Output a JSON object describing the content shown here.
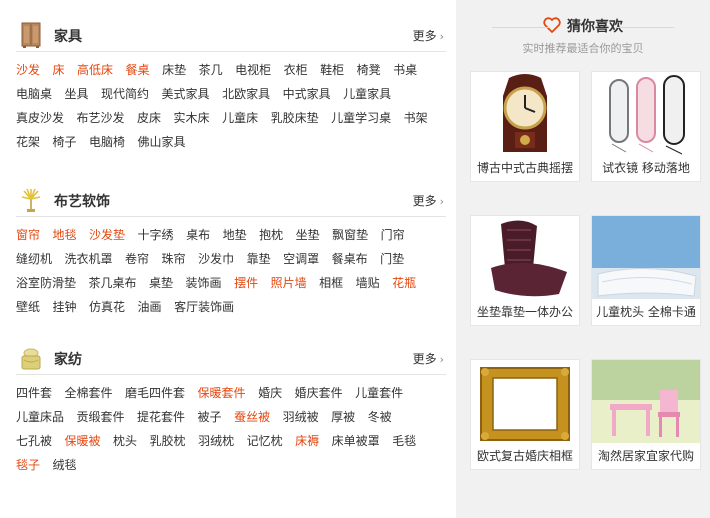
{
  "sections": [
    {
      "title": "家具",
      "more": "更多",
      "icon": "wardrobe-icon",
      "links": [
        {
          "t": "沙发",
          "hot": true
        },
        {
          "t": "床",
          "hot": true
        },
        {
          "t": "高低床",
          "hot": true
        },
        {
          "t": "餐桌",
          "hot": true
        },
        {
          "t": "床垫",
          "hot": false
        },
        {
          "t": "茶几",
          "hot": false
        },
        {
          "t": "电视柜",
          "hot": false
        },
        {
          "t": "衣柜",
          "hot": false
        },
        {
          "t": "鞋柜",
          "hot": false
        },
        {
          "t": "椅凳",
          "hot": false
        },
        {
          "t": "书桌",
          "hot": false
        },
        {
          "t": "电脑桌",
          "hot": false
        },
        {
          "t": "坐具",
          "hot": false
        },
        {
          "t": "现代简约",
          "hot": false
        },
        {
          "t": "美式家具",
          "hot": false
        },
        {
          "t": "北欧家具",
          "hot": false
        },
        {
          "t": "中式家具",
          "hot": false
        },
        {
          "t": "儿童家具",
          "hot": false
        },
        {
          "t": "真皮沙发",
          "hot": false
        },
        {
          "t": "布艺沙发",
          "hot": false
        },
        {
          "t": "皮床",
          "hot": false
        },
        {
          "t": "实木床",
          "hot": false
        },
        {
          "t": "儿童床",
          "hot": false
        },
        {
          "t": "乳胶床垫",
          "hot": false
        },
        {
          "t": "儿童学习桌",
          "hot": false
        },
        {
          "t": "书架",
          "hot": false
        },
        {
          "t": "花架",
          "hot": false
        },
        {
          "t": "椅子",
          "hot": false
        },
        {
          "t": "电脑椅",
          "hot": false
        },
        {
          "t": "佛山家具",
          "hot": false
        }
      ]
    },
    {
      "title": "布艺软饰",
      "more": "更多",
      "icon": "plant-icon",
      "links": [
        {
          "t": "窗帘",
          "hot": true
        },
        {
          "t": "地毯",
          "hot": true
        },
        {
          "t": "沙发垫",
          "hot": true
        },
        {
          "t": "十字绣",
          "hot": false
        },
        {
          "t": "桌布",
          "hot": false
        },
        {
          "t": "地垫",
          "hot": false
        },
        {
          "t": "抱枕",
          "hot": false
        },
        {
          "t": "坐垫",
          "hot": false
        },
        {
          "t": "飘窗垫",
          "hot": false
        },
        {
          "t": "门帘",
          "hot": false
        },
        {
          "t": "缝纫机",
          "hot": false
        },
        {
          "t": "洗衣机罩",
          "hot": false
        },
        {
          "t": "卷帘",
          "hot": false
        },
        {
          "t": "珠帘",
          "hot": false
        },
        {
          "t": "沙发巾",
          "hot": false
        },
        {
          "t": "靠垫",
          "hot": false
        },
        {
          "t": "空调罩",
          "hot": false
        },
        {
          "t": "餐桌布",
          "hot": false
        },
        {
          "t": "门垫",
          "hot": false
        },
        {
          "t": "浴室防滑垫",
          "hot": false
        },
        {
          "t": "茶几桌布",
          "hot": false
        },
        {
          "t": "桌垫",
          "hot": false
        },
        {
          "t": "装饰画",
          "hot": false
        },
        {
          "t": "摆件",
          "hot": true
        },
        {
          "t": "照片墙",
          "hot": true
        },
        {
          "t": "相框",
          "hot": false
        },
        {
          "t": "墙贴",
          "hot": false
        },
        {
          "t": "花瓶",
          "hot": true
        },
        {
          "t": "壁纸",
          "hot": false
        },
        {
          "t": "挂钟",
          "hot": false
        },
        {
          "t": "仿真花",
          "hot": false
        },
        {
          "t": "油画",
          "hot": false
        },
        {
          "t": "客厅装饰画",
          "hot": false
        }
      ]
    },
    {
      "title": "家纺",
      "more": "更多",
      "icon": "bedding-icon",
      "links": [
        {
          "t": "四件套",
          "hot": false
        },
        {
          "t": "全棉套件",
          "hot": false
        },
        {
          "t": "磨毛四件套",
          "hot": false
        },
        {
          "t": "保暖套件",
          "hot": true
        },
        {
          "t": "婚庆",
          "hot": false
        },
        {
          "t": "婚庆套件",
          "hot": false
        },
        {
          "t": "儿童套件",
          "hot": false
        },
        {
          "t": "儿童床品",
          "hot": false
        },
        {
          "t": "贡缎套件",
          "hot": false
        },
        {
          "t": "提花套件",
          "hot": false
        },
        {
          "t": "被子",
          "hot": false
        },
        {
          "t": "蚕丝被",
          "hot": true
        },
        {
          "t": "羽绒被",
          "hot": false
        },
        {
          "t": "厚被",
          "hot": false
        },
        {
          "t": "冬被",
          "hot": false
        },
        {
          "t": "七孔被",
          "hot": false
        },
        {
          "t": "保暖被",
          "hot": true
        },
        {
          "t": "枕头",
          "hot": false
        },
        {
          "t": "乳胶枕",
          "hot": false
        },
        {
          "t": "羽绒枕",
          "hot": false
        },
        {
          "t": "记忆枕",
          "hot": false
        },
        {
          "t": "床褥",
          "hot": true
        },
        {
          "t": "床单被罩",
          "hot": false
        },
        {
          "t": "毛毯",
          "hot": false
        },
        {
          "t": "毯子",
          "hot": true
        },
        {
          "t": "绒毯",
          "hot": false
        }
      ]
    }
  ],
  "guess": {
    "title": "猜你喜欢",
    "subtitle": "实时推荐最适合你的宝贝",
    "items": [
      {
        "caption": "博古中式古典摇摆",
        "image": "clock-image"
      },
      {
        "caption": "试衣镜 移动落地",
        "image": "mirror-image"
      },
      {
        "caption": "坐垫靠垫一体办公",
        "image": "cushion-image"
      },
      {
        "caption": "儿童枕头 全棉卡通",
        "image": "pillow-image"
      },
      {
        "caption": "欧式复古婚庆相框",
        "image": "frame-image"
      },
      {
        "caption": "淘然居家宜家代购",
        "image": "kids-table-image"
      }
    ]
  },
  "colors": {
    "hot": "#e4470f",
    "sidebar_bg": "#f1f1f1",
    "heart": "#e4470f"
  }
}
